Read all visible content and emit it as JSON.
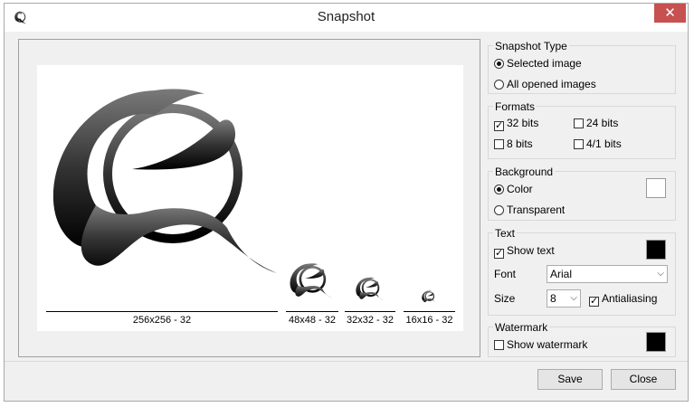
{
  "window": {
    "title": "Snapshot",
    "close_label": "✕"
  },
  "preview": {
    "captions": [
      "256x256 - 32",
      "48x48 - 32",
      "32x32 - 32",
      "16x16 - 32"
    ]
  },
  "snapshot_type": {
    "title": "Snapshot Type",
    "options": [
      {
        "label": "Selected image",
        "selected": true
      },
      {
        "label": "All opened images",
        "selected": false
      }
    ]
  },
  "formats": {
    "title": "Formats",
    "items": [
      {
        "label": "32 bits",
        "checked": true
      },
      {
        "label": "24 bits",
        "checked": false
      },
      {
        "label": "8 bits",
        "checked": false
      },
      {
        "label": "4/1 bits",
        "checked": false
      }
    ]
  },
  "background": {
    "title": "Background",
    "options": [
      {
        "label": "Color",
        "selected": true
      },
      {
        "label": "Transparent",
        "selected": false
      }
    ],
    "color": "#ffffff"
  },
  "text": {
    "title": "Text",
    "show_text_label": "Show text",
    "show_text_checked": true,
    "color": "#000000",
    "font_label": "Font",
    "font_value": "Arial",
    "size_label": "Size",
    "size_value": "8",
    "antialiasing_label": "Antialiasing",
    "antialiasing_checked": true
  },
  "watermark": {
    "title": "Watermark",
    "show_label": "Show watermark",
    "show_checked": false,
    "color": "#000000"
  },
  "buttons": {
    "save": "Save",
    "close": "Close"
  }
}
